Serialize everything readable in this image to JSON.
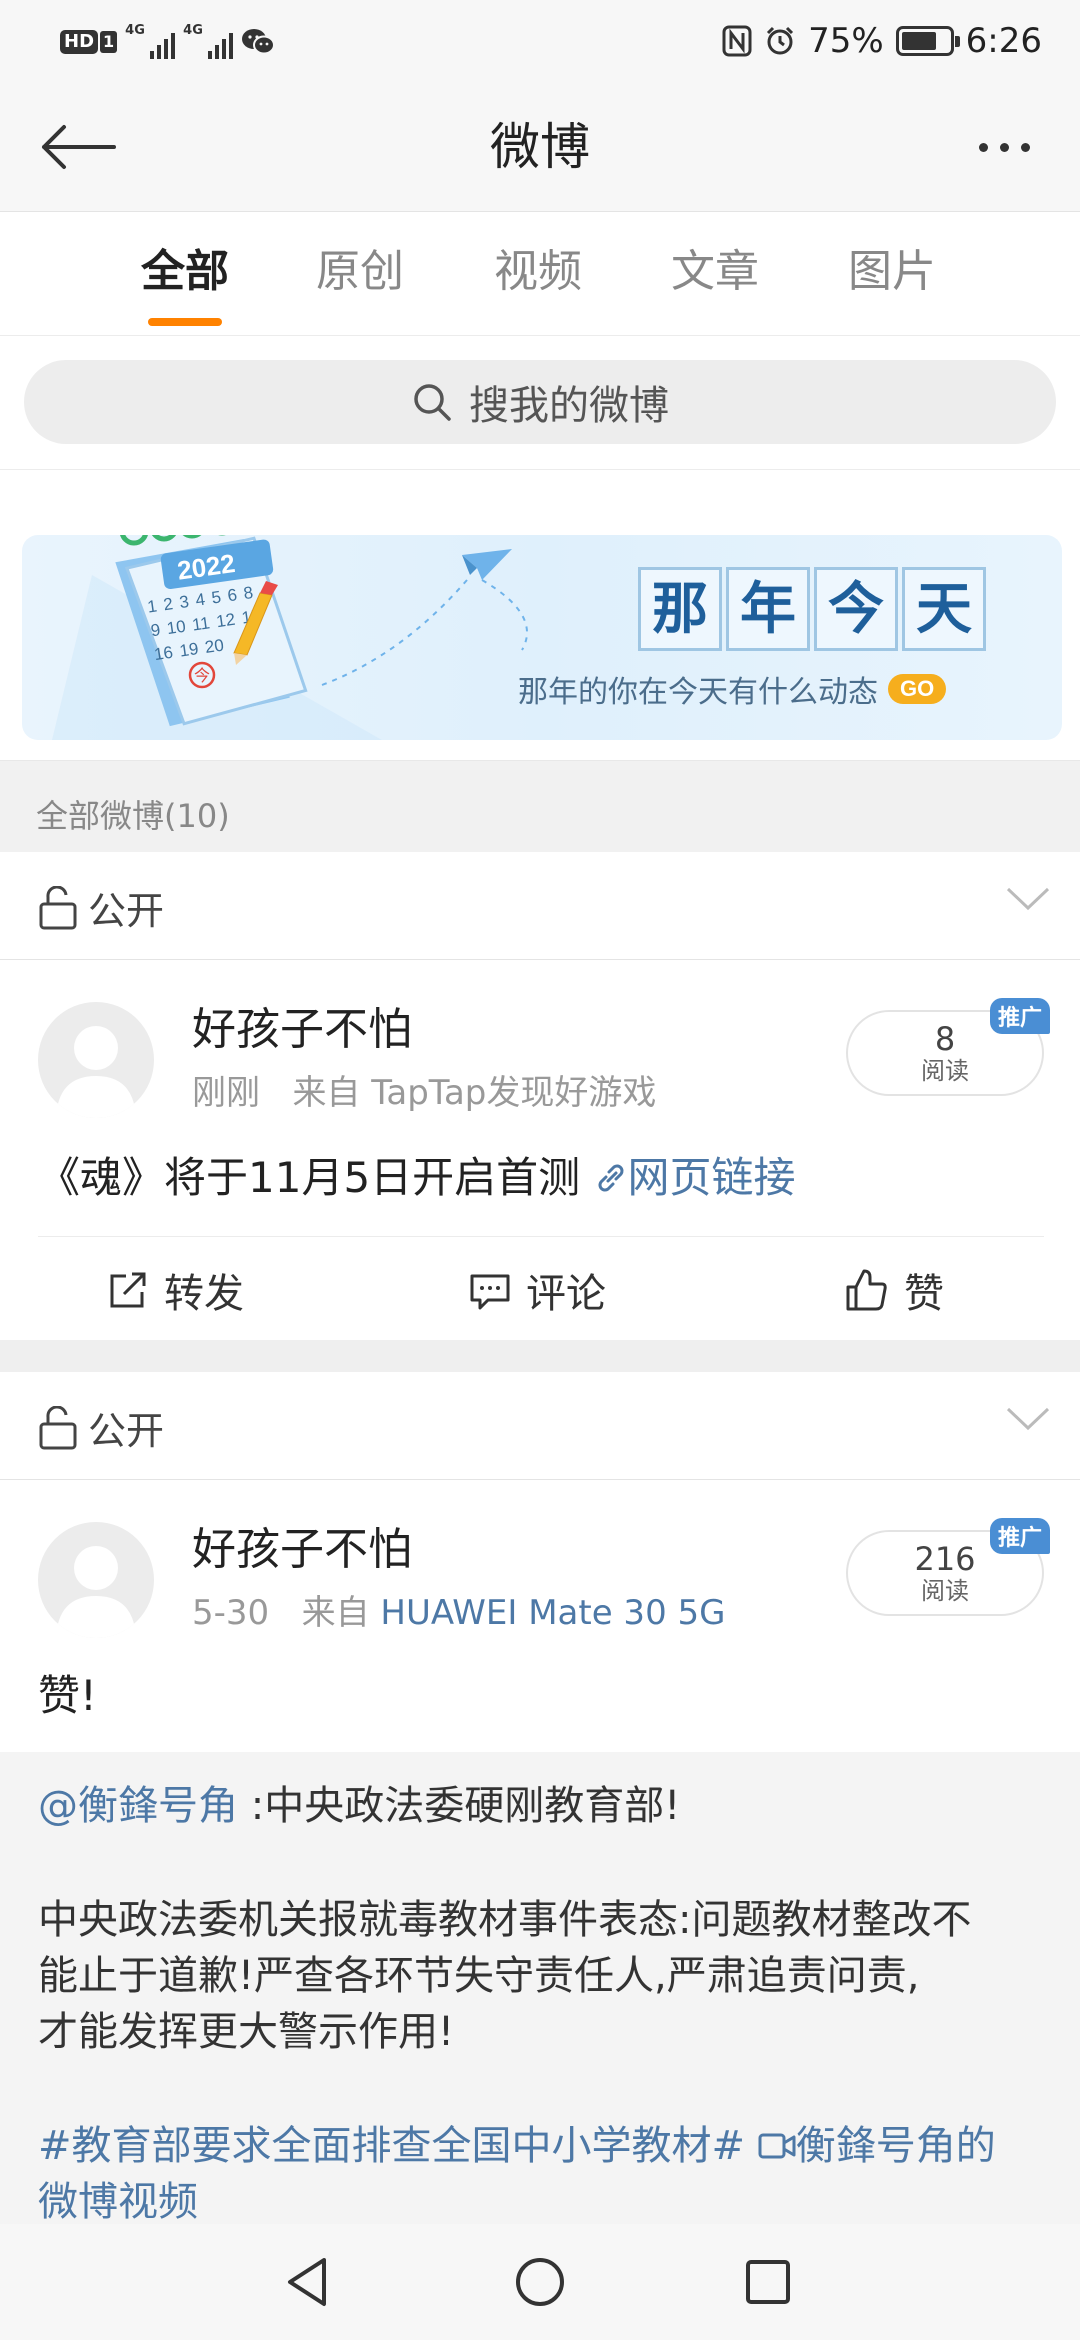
{
  "status_bar": {
    "hd": "HD",
    "sim": "1",
    "net1": "4G",
    "net2": "4G",
    "nfc": "N",
    "battery_percent": "75%",
    "battery_level": 0.75,
    "time": "6:26"
  },
  "header": {
    "title": "微博"
  },
  "tabs": [
    {
      "label": "全部",
      "active": true
    },
    {
      "label": "原创",
      "active": false
    },
    {
      "label": "视频",
      "active": false
    },
    {
      "label": "文章",
      "active": false
    },
    {
      "label": "图片",
      "active": false
    }
  ],
  "search": {
    "placeholder": "搜我的微博"
  },
  "banner": {
    "calendar_year": "2022",
    "calendar_days": "1 2 3 4 5 6 8 9 10 11 12 15 16 19 20",
    "calendar_today": "今",
    "title_chars": [
      "那",
      "年",
      "今",
      "天"
    ],
    "subtitle": "那年的你在今天有什么动态",
    "go_label": "GO"
  },
  "section": {
    "label": "全部微博(10)"
  },
  "posts": [
    {
      "visibility": "公开",
      "author": "好孩子不怕",
      "time": "刚刚",
      "source_prefix": "来自",
      "source": "TapTap发现好游戏",
      "read_count": "8",
      "read_label": "阅读",
      "promo": "推广",
      "text": "《魂》将于11月5日开启首测",
      "link_text": "网页链接",
      "actions": {
        "repost": "转发",
        "comment": "评论",
        "like": "赞"
      }
    },
    {
      "visibility": "公开",
      "author": "好孩子不怕",
      "time": "5-30",
      "source_prefix": "来自",
      "source": "HUAWEI Mate 30 5G",
      "read_count": "216",
      "read_label": "阅读",
      "promo": "推广",
      "text": "赞!",
      "quote": {
        "mention": "@衡鋒号角",
        "headline": ":中央政法委硬刚教育部!",
        "body_line1": "中央政法委机关报就毒教材事件表态:问题教材整改不",
        "body_line2": "能止于道歉!严查各环节失守责任人,严肃追责问责,",
        "body_line3": "才能发挥更大警示作用!",
        "hashtag": "#教育部要求全面排查全国中小学教材#",
        "video_link_line1": "衡鋒号角的",
        "video_link_line2": "微博视频"
      }
    }
  ]
}
